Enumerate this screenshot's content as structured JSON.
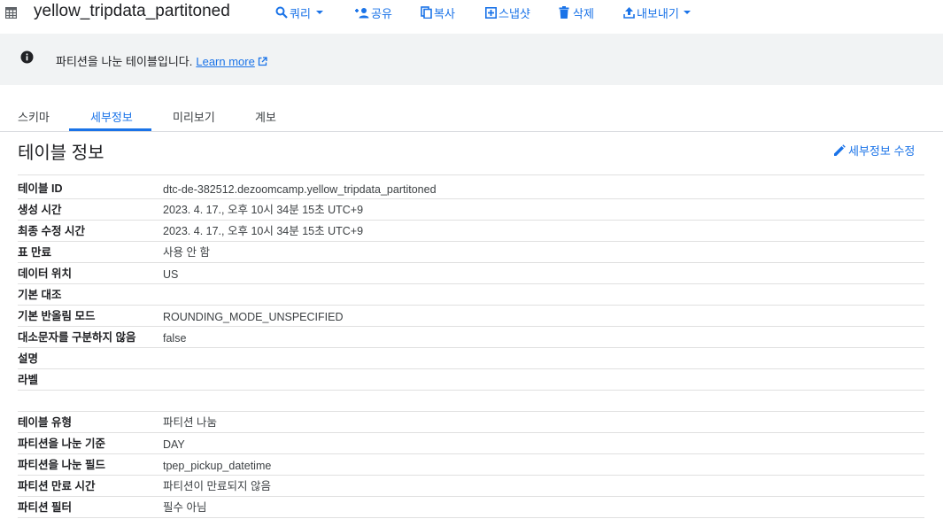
{
  "header": {
    "title": "yellow_tripdata_partitoned",
    "buttons": {
      "query": "쿼리",
      "share": "공유",
      "copy": "복사",
      "snapshot": "스냅샷",
      "delete": "삭제",
      "export": "내보내기"
    }
  },
  "banner": {
    "text": "파티션을 나눈 테이블입니다.",
    "link": "Learn more"
  },
  "tabs": [
    "스키마",
    "세부정보",
    "미리보기",
    "계보"
  ],
  "active_tab": "세부정보",
  "section": {
    "title": "테이블 정보",
    "edit_label": "세부정보 수정"
  },
  "table_info": [
    {
      "label": "테이블 ID",
      "value": "dtc-de-382512.dezoomcamp.yellow_tripdata_partitoned"
    },
    {
      "label": "생성 시간",
      "value": "2023. 4. 17., 오후 10시 34분 15초 UTC+9"
    },
    {
      "label": "최종 수정 시간",
      "value": "2023. 4. 17., 오후 10시 34분 15초 UTC+9"
    },
    {
      "label": "표 만료",
      "value": "사용 안 함"
    },
    {
      "label": "데이터 위치",
      "value": "US"
    },
    {
      "label": "기본 대조",
      "value": ""
    },
    {
      "label": "기본 반올림 모드",
      "value": "ROUNDING_MODE_UNSPECIFIED"
    },
    {
      "label": "대소문자를 구분하지 않음",
      "value": "false"
    },
    {
      "label": "설명",
      "value": ""
    },
    {
      "label": "라벨",
      "value": ""
    }
  ],
  "partition_info": [
    {
      "label": "테이블 유형",
      "value": "파티션 나눔"
    },
    {
      "label": "파티션을 나눈 기준",
      "value": "DAY"
    },
    {
      "label": "파티션을 나눈 필드",
      "value": "tpep_pickup_datetime"
    },
    {
      "label": "파티션 만료 시간",
      "value": "파티션이 만료되지 않음"
    },
    {
      "label": "파티션 필터",
      "value": "필수 아님"
    }
  ],
  "colors": {
    "accent": "#1a73e8",
    "banner_bg": "#f1f3f4",
    "divider": "#e0e0e0"
  },
  "icons": [
    "table-icon",
    "search-icon",
    "person-add-icon",
    "copy-icon",
    "snapshot-icon",
    "delete-icon",
    "upload-icon",
    "info-icon",
    "external-link-icon",
    "pencil-icon"
  ]
}
